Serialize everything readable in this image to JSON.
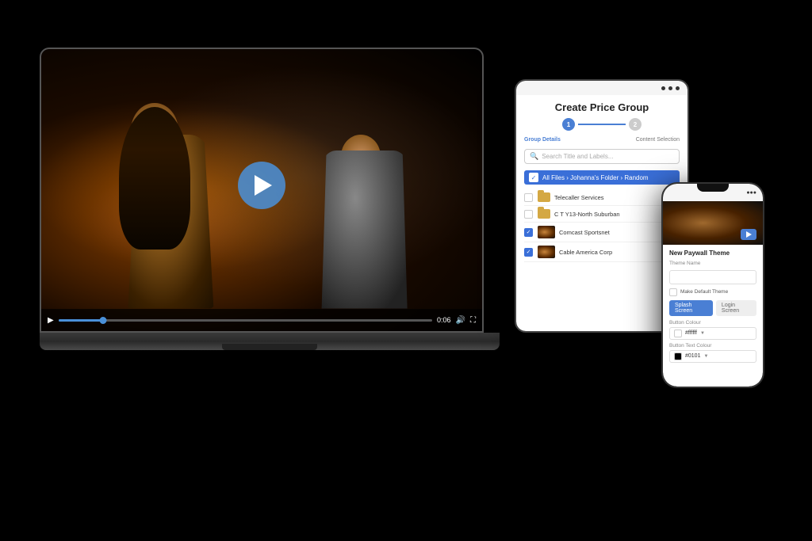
{
  "background": "#000",
  "laptop": {
    "video": {
      "play_button_label": "Play",
      "time_current": "0:06",
      "time_total": "0:06",
      "progress_percent": 12
    }
  },
  "tablet": {
    "title": "Create Price Group",
    "steps": [
      {
        "label": "Group Details",
        "number": "1",
        "state": "active"
      },
      {
        "label": "Content Selection",
        "number": "2",
        "state": "inactive"
      }
    ],
    "search": {
      "placeholder": "Search Title and Labels..."
    },
    "breadcrumb": "All Files › Johanna's Folder › Random",
    "files": [
      {
        "name": "Telecaller Services",
        "type": "folder",
        "checked": false
      },
      {
        "name": "C T Y13-North Suburban",
        "type": "folder",
        "checked": false
      },
      {
        "name": "Comcast Sportsnet",
        "type": "video",
        "checked": true
      },
      {
        "name": "Cable America Corp",
        "type": "video",
        "checked": true
      }
    ]
  },
  "phone": {
    "section_title": "New Paywall Theme",
    "fields": {
      "theme_name_label": "Theme Name",
      "theme_name_value": "",
      "make_default_label": "Make Default Theme",
      "button_color_label": "Button Colour",
      "button_color_value": "#ffffff",
      "button_color_hex": "#ffffff",
      "button_text_color_label": "Button Text Colour",
      "button_text_color_value": "#0101",
      "button_text_color_hex": "#0101"
    },
    "tabs": [
      {
        "label": "Splash Screen",
        "active": true
      },
      {
        "label": "Login Screen",
        "active": false
      }
    ]
  }
}
